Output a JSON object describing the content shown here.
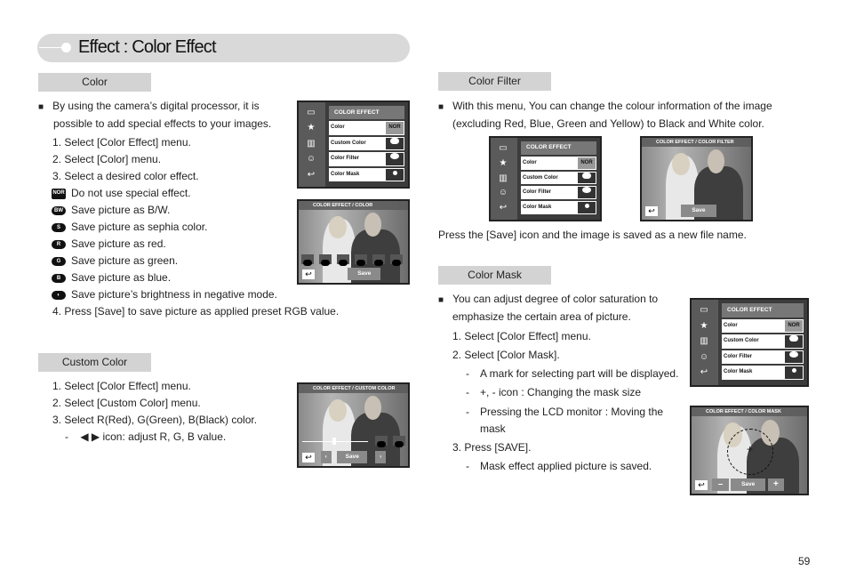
{
  "header": {
    "title": "Effect : Color Effect"
  },
  "color": {
    "label": "Color",
    "intro": [
      "By using the camera’s digital processor, it is",
      "possible to add special effects to your images."
    ],
    "steps": [
      "1.  Select [Color Effect] menu.",
      "2.  Select [Color] menu.",
      "3.  Select a desired color effect."
    ],
    "options": [
      {
        "icon": "NOR",
        "text": "Do not use special effect."
      },
      {
        "icon": "BW",
        "text": "Save picture as B/W."
      },
      {
        "icon": "S",
        "text": "Save picture as sephia color."
      },
      {
        "icon": "R",
        "text": "Save picture as red."
      },
      {
        "icon": "G",
        "text": "Save picture as green."
      },
      {
        "icon": "B",
        "text": "Save picture as blue."
      },
      {
        "icon": "negative",
        "text": "Save picture’s brightness in negative mode."
      }
    ],
    "step4": "4.  Press [Save] to save picture as applied preset RGB value.",
    "screen_title": "COLOR EFFECT / COLOR",
    "chips": [
      "BW",
      "S",
      "R",
      "G",
      "B",
      ""
    ]
  },
  "custom": {
    "label": "Custom Color",
    "steps": [
      "1.  Select [Color Effect] menu.",
      "2.  Select [Custom Color] menu.",
      "3.  Select R(Red), G(Green), B(Black) color."
    ],
    "sub": "◀ ▶ icon: adjust R, G, B value.",
    "sub_dash": "-",
    "screen_title": "COLOR EFFECT / CUSTOM COLOR",
    "chips": [
      "G",
      "B"
    ]
  },
  "filter": {
    "label": "Color Filter",
    "intro": [
      "With this menu, You can change the colour information of the image",
      "(excluding Red, Blue, Green and Yellow) to Black and White color."
    ],
    "note": "Press the [Save] icon and the image is saved as a new file name.",
    "screen_title": "COLOR EFFECT / COLOR FILTER"
  },
  "mask": {
    "label": "Color Mask",
    "intro": [
      "You can adjust degree of color saturation to",
      "emphasize the certain area of picture."
    ],
    "steps": [
      "1.  Select [Color Effect] menu.",
      "2.  Select [Color Mask]."
    ],
    "subs": [
      [
        "A mark for selecting part will be displayed."
      ],
      [
        "+, - icon : Changing the mask size"
      ],
      [
        "Pressing the LCD monitor : Moving the",
        "mask"
      ]
    ],
    "step3": "3.  Press [SAVE].",
    "step3_sub": "Mask effect applied picture is saved.",
    "screen_title": "COLOR EFFECT / COLOR MASK",
    "minus": "–",
    "plus": "+"
  },
  "menu": {
    "title": "COLOR EFFECT",
    "items": [
      {
        "label": "Color",
        "value": "NOR"
      },
      {
        "label": "Custom Color",
        "value": "C"
      },
      {
        "label": "Color Filter",
        "value": "palette"
      },
      {
        "label": "Color Mask",
        "value": "mask"
      }
    ]
  },
  "save_label": "Save",
  "bullet": "■",
  "page_number": "59"
}
